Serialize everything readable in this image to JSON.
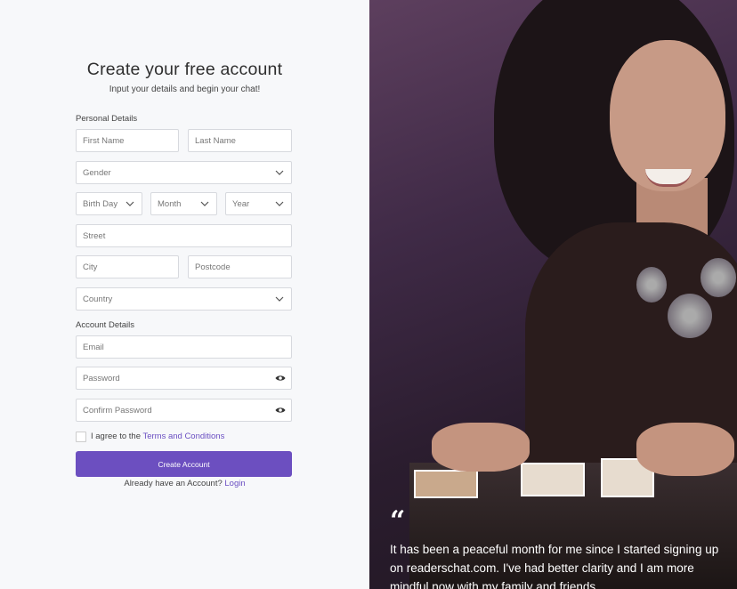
{
  "form": {
    "title": "Create your free account",
    "subtitle": "Input your details and begin your chat!",
    "personal_label": "Personal Details",
    "account_label": "Account Details",
    "first_name_placeholder": "First Name",
    "last_name_placeholder": "Last Name",
    "gender_placeholder": "Gender",
    "birth_day_placeholder": "Birth Day",
    "month_placeholder": "Month",
    "year_placeholder": "Year",
    "street_placeholder": "Street",
    "city_placeholder": "City",
    "postcode_placeholder": "Postcode",
    "country_placeholder": "Country",
    "email_placeholder": "Email",
    "password_placeholder": "Password",
    "confirm_password_placeholder": "Confirm Password",
    "agree_text": "I agree to the",
    "terms_link": "Terms and Conditions",
    "create_button": "Create Account",
    "already_text": "Already have an Account?",
    "login_link": "Login"
  },
  "testimonial": {
    "quote_mark": "“",
    "text": "It has been a peaceful month for me since I started signing up on readerschat.com. I've had better clarity and I am more mindful now with my family and friends."
  },
  "colors": {
    "accent": "#6c4fc0",
    "link": "#6a4fc2"
  },
  "icons": {
    "dropdown": "chevron-down-icon",
    "password_toggle": "eye-icon",
    "quote": "quote-icon"
  }
}
